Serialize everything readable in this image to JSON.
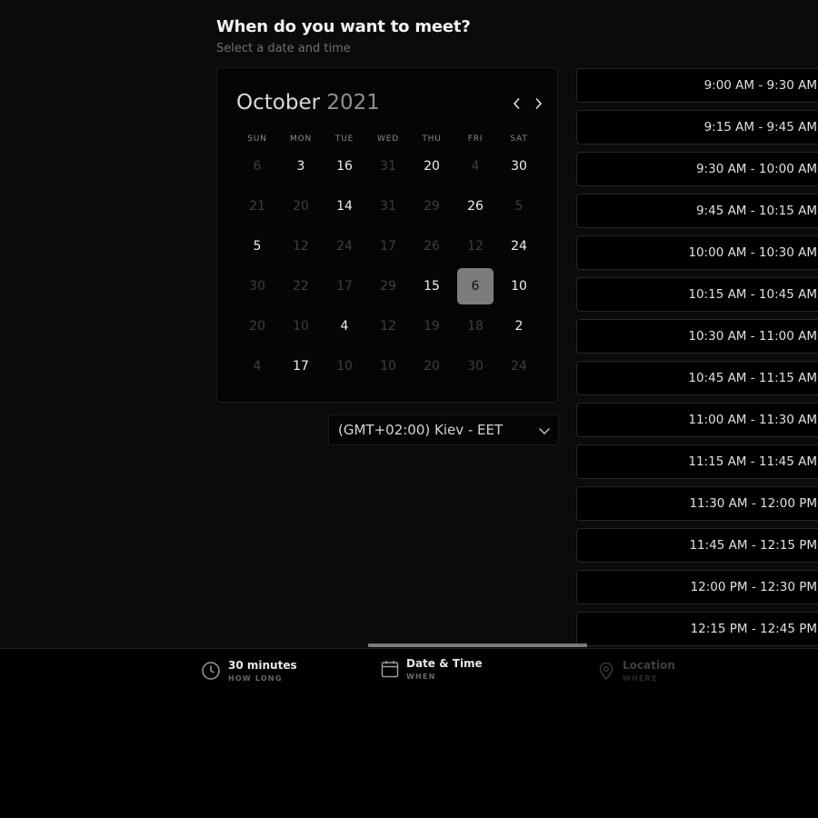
{
  "header": {
    "title": "When do you want to meet?",
    "subtitle": "Select a date and time"
  },
  "calendar": {
    "month": "October",
    "year": "2021",
    "weekdays": [
      "SUN",
      "MON",
      "TUE",
      "WED",
      "THU",
      "FRI",
      "SAT"
    ],
    "weeks": [
      [
        {
          "d": "6",
          "s": "off"
        },
        {
          "d": "3",
          "s": "on"
        },
        {
          "d": "16",
          "s": "on"
        },
        {
          "d": "31",
          "s": "off"
        },
        {
          "d": "20",
          "s": "on"
        },
        {
          "d": "4",
          "s": "off"
        },
        {
          "d": "30",
          "s": "on"
        }
      ],
      [
        {
          "d": "21",
          "s": "off"
        },
        {
          "d": "20",
          "s": "off"
        },
        {
          "d": "14",
          "s": "on"
        },
        {
          "d": "31",
          "s": "off"
        },
        {
          "d": "29",
          "s": "off"
        },
        {
          "d": "26",
          "s": "on"
        },
        {
          "d": "5",
          "s": "off"
        }
      ],
      [
        {
          "d": "5",
          "s": "on"
        },
        {
          "d": "12",
          "s": "off"
        },
        {
          "d": "24",
          "s": "off"
        },
        {
          "d": "17",
          "s": "off"
        },
        {
          "d": "26",
          "s": "off"
        },
        {
          "d": "12",
          "s": "off"
        },
        {
          "d": "24",
          "s": "on"
        }
      ],
      [
        {
          "d": "30",
          "s": "off"
        },
        {
          "d": "22",
          "s": "off"
        },
        {
          "d": "17",
          "s": "off"
        },
        {
          "d": "29",
          "s": "off"
        },
        {
          "d": "15",
          "s": "on"
        },
        {
          "d": "6",
          "s": "sel"
        },
        {
          "d": "10",
          "s": "on"
        }
      ],
      [
        {
          "d": "20",
          "s": "off"
        },
        {
          "d": "10",
          "s": "off"
        },
        {
          "d": "4",
          "s": "on"
        },
        {
          "d": "12",
          "s": "off"
        },
        {
          "d": "19",
          "s": "off"
        },
        {
          "d": "18",
          "s": "off"
        },
        {
          "d": "2",
          "s": "on"
        }
      ],
      [
        {
          "d": "4",
          "s": "off"
        },
        {
          "d": "17",
          "s": "on"
        },
        {
          "d": "10",
          "s": "off"
        },
        {
          "d": "10",
          "s": "off"
        },
        {
          "d": "20",
          "s": "off"
        },
        {
          "d": "30",
          "s": "off"
        },
        {
          "d": "24",
          "s": "off"
        }
      ]
    ]
  },
  "timezone": {
    "label": "(GMT+02:00) Kiev - EET",
    "icon": "chevron-down-icon"
  },
  "time_slots": [
    "9:00 AM - 9:30 AM",
    "9:15 AM - 9:45 AM",
    "9:30 AM - 10:00 AM",
    "9:45 AM - 10:15 AM",
    "10:00 AM - 10:30 AM",
    "10:15 AM - 10:45 AM",
    "10:30 AM - 11:00 AM",
    "10:45 AM - 11:15 AM",
    "11:00 AM - 11:30 AM",
    "11:15 AM - 11:45 AM",
    "11:30 AM - 12:00 PM",
    "11:45 AM - 12:15 PM",
    "12:00 PM - 12:30 PM",
    "12:15 PM - 12:45 PM"
  ],
  "progress": {
    "current_step": 2,
    "total_steps": 3
  },
  "steps": [
    {
      "title": "30 minutes",
      "sub": "HOW LONG",
      "icon": "clock-icon",
      "state": "active"
    },
    {
      "title": "Date & Time",
      "sub": "WHEN",
      "icon": "calendar-icon",
      "state": "active"
    },
    {
      "title": "Location",
      "sub": "WHERE",
      "icon": "location-pin-icon",
      "state": "inactive"
    }
  ],
  "colors": {
    "background": "#000000",
    "panel": "#0b0b0b",
    "selected_day": "#7c7c7c",
    "progress_bar": "#7a7a7a",
    "text_primary": "#f0f0f0",
    "text_muted": "#3e3e3e"
  }
}
